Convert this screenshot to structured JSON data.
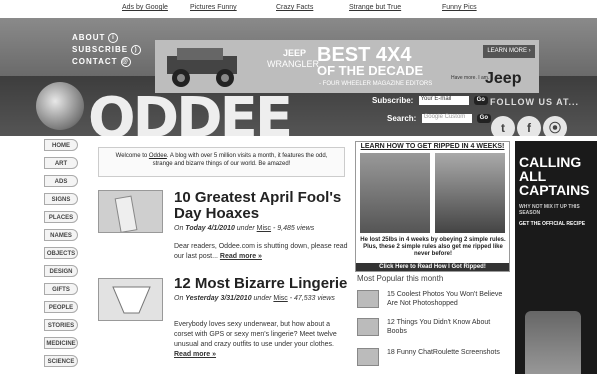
{
  "top_links": [
    "Ads by Google",
    "Pictures Funny",
    "Crazy Facts",
    "Strange but True",
    "Funny Pics"
  ],
  "header_nav": {
    "about": "ABOUT",
    "subscribe": "SUBSCRIBE",
    "contact": "CONTACT"
  },
  "banner_ad": {
    "line1": "JEEP",
    "line2": "WRANGLER",
    "headline": "BEST 4X4",
    "subheadline": "OF THE DECADE",
    "attribution": "- FOUR WHEELER MAGAZINE EDITORS",
    "cta": "LEARN MORE ›",
    "brand": "Jeep",
    "tagline": "Have more. I am."
  },
  "logo_text": "ODDEE",
  "subscribe_form": {
    "label": "Subscribe:",
    "placeholder": "Your E-mail",
    "button": "Go"
  },
  "search_form": {
    "label": "Search:",
    "placeholder": "Google Custom",
    "button": "Go"
  },
  "follow": {
    "title": "FOLLOW US AT...",
    "icons": [
      "twitter-icon",
      "facebook-icon",
      "rss-icon"
    ]
  },
  "sidebar": [
    "HOME",
    "ART",
    "ADS",
    "SIGNS",
    "PLACES",
    "NAMES",
    "OBJECTS",
    "DESIGN",
    "GIFTS",
    "PEOPLE",
    "STORIES",
    "MEDICINE",
    "SCIENCE"
  ],
  "welcome": {
    "prefix": "Welcome to ",
    "site": "Oddee",
    "suffix": ". A blog with over 5 million visits a month, it features the odd, strange and bizarre things of our world. Be amazed!"
  },
  "posts": [
    {
      "title": "10 Greatest April Fool's Day Hoaxes",
      "on": "On ",
      "date": "Today 4/1/2010",
      "under": " under ",
      "category": "Misc",
      "views": " - 9,485 views",
      "excerpt": "Dear readers, Oddee.com is shutting down, please read our last post...",
      "more": "Read more »"
    },
    {
      "title": "12 Most Bizarre Lingerie",
      "on": "On ",
      "date": "Yesterday 3/31/2010",
      "under": " under ",
      "category": "Misc",
      "views": " - 47,533 views",
      "excerpt": "Everybody loves sexy underwear, but how about a corset with GPS or sexy men's lingerie? Meet twelve unusual and crazy outfits to use under your clothes.",
      "more": "Read more »"
    }
  ],
  "rip_ad": {
    "headline": "LEARN HOW TO GET RIPPED IN 4 WEEKS!",
    "caption": "He lost 25lbs in 4 weeks by obeying 2 simple rules. Plus, these 2 simple rules also get me ripped like never before!",
    "cta": "Click Here to Read How I Got Ripped!"
  },
  "most_popular": {
    "title": "Most Popular this month",
    "items": [
      "15 Coolest Photos You Won't Believe Are Not Photoshopped",
      "12 Things You Didn't Know About Boobs",
      "18 Funny ChatRoulette Screenshots"
    ]
  },
  "captain_ad": {
    "headline": "CALLING ALL CAPTAINS",
    "tagline": "WHY NOT MIX IT UP THIS SEASON",
    "cta": "GET THE OFFICIAL RECIPE"
  }
}
